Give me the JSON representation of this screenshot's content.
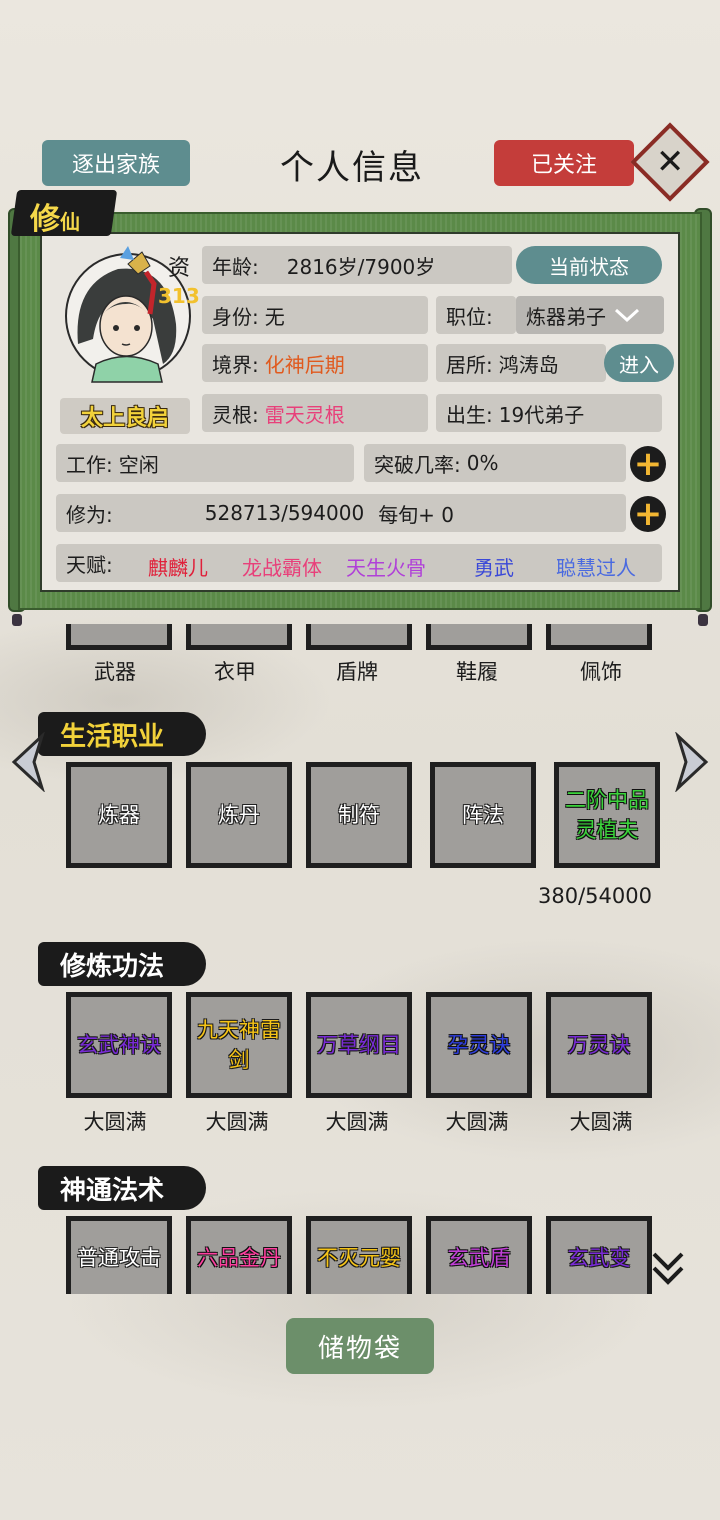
{
  "header": {
    "leave_clan": "逐出家族",
    "title": "个人信息",
    "followed": "已关注"
  },
  "badge": {
    "main": "修",
    "sub": "仙"
  },
  "character": {
    "aptitude_label": "资",
    "aptitude_value": "313",
    "name": "太上良启"
  },
  "fields": {
    "age_label": "年龄:",
    "age_value": "2816岁/7900岁",
    "status_button": "当前状态",
    "identity_label": "身份:",
    "identity_value": "无",
    "position_label": "职位:",
    "position_value": "炼器弟子",
    "realm_label": "境界:",
    "realm_value": "化神后期",
    "residence_label": "居所:",
    "residence_value": "鸿涛岛",
    "enter_button": "进入",
    "root_label": "灵根:",
    "root_value": "雷天灵根",
    "birth_label": "出生:",
    "birth_value": "19代弟子",
    "work_label": "工作:",
    "work_value": "空闲",
    "breakthrough_label": "突破几率:",
    "breakthrough_value": "0%",
    "cultivation_label": "修为:",
    "cultivation_value": "528713/594000",
    "cultivation_rate": "每旬+ 0",
    "talent_label": "天赋:",
    "talents": [
      "麒麟儿",
      "龙战霸体",
      "天生火骨",
      "勇武",
      "聪慧过人"
    ],
    "talent_colors": [
      "#e0203a",
      "#e8407a",
      "#b040d8",
      "#3a48d8",
      "#4a6ae0"
    ]
  },
  "equipment": [
    "武器",
    "衣甲",
    "盾牌",
    "鞋履",
    "佩饰"
  ],
  "life_jobs": {
    "title": "生活职业",
    "items": [
      "炼器",
      "炼丹",
      "制符",
      "阵法",
      "二阶中品灵植夫"
    ],
    "progress_text": "380/54000"
  },
  "techniques": {
    "title": "修炼功法",
    "items": [
      "玄武神诀",
      "九天神雷剑",
      "万草纲目",
      "孕灵诀",
      "万灵诀"
    ],
    "levels": [
      "大圆满",
      "大圆满",
      "大圆满",
      "大圆满",
      "大圆满"
    ]
  },
  "skills": {
    "title": "神通法术",
    "items": [
      "普通攻击",
      "六品金丹",
      "不灭元婴",
      "玄武盾",
      "玄武变"
    ]
  },
  "storage_button": "储物袋",
  "icons": [
    "close-icon",
    "chevron-down-icon",
    "plus-icon",
    "arrow-left-icon",
    "arrow-right-icon",
    "double-chevron-down-icon"
  ]
}
